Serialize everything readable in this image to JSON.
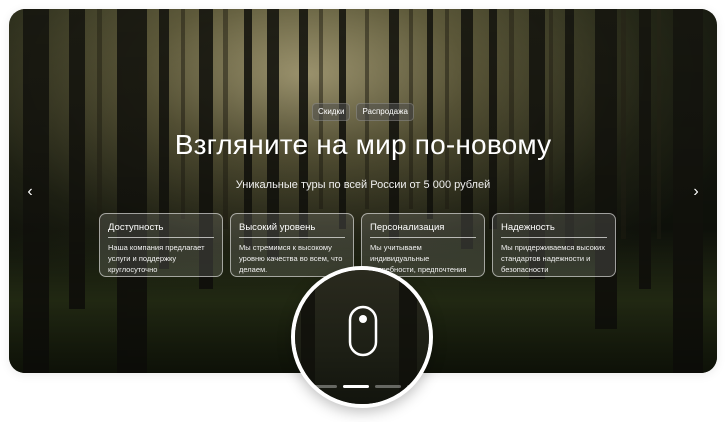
{
  "hero": {
    "tags": [
      "Скидки",
      "Распродажа"
    ],
    "title": "Взгляните на мир по-новому",
    "subtitle": "Уникальные туры по всей России от 5 000 рублей",
    "prev_icon": "chevron-left-icon",
    "next_icon": "chevron-right-icon",
    "prev_label": "‹",
    "next_label": "›"
  },
  "cards": [
    {
      "title": "Доступность",
      "text": "Наша компания предлагает услуги и поддержку круглосуточно"
    },
    {
      "title": "Высокий уровень",
      "text": "Мы стремимся к высокому уровню качества во всем, что делаем."
    },
    {
      "title": "Персонализация",
      "text": "Мы учитываем индивидуальные потребности, предпочтения"
    },
    {
      "title": "Надежность",
      "text": "Мы придерживаемся высоких стандартов надежности и безопасности"
    }
  ],
  "magnifier": {
    "icon": "mouse-scroll-icon",
    "slides_total": 4,
    "slide_active": 2
  },
  "colors": {
    "accent": "#ffffff",
    "forest_dark": "#1f2a16",
    "forest_light": "#b9b56a"
  }
}
